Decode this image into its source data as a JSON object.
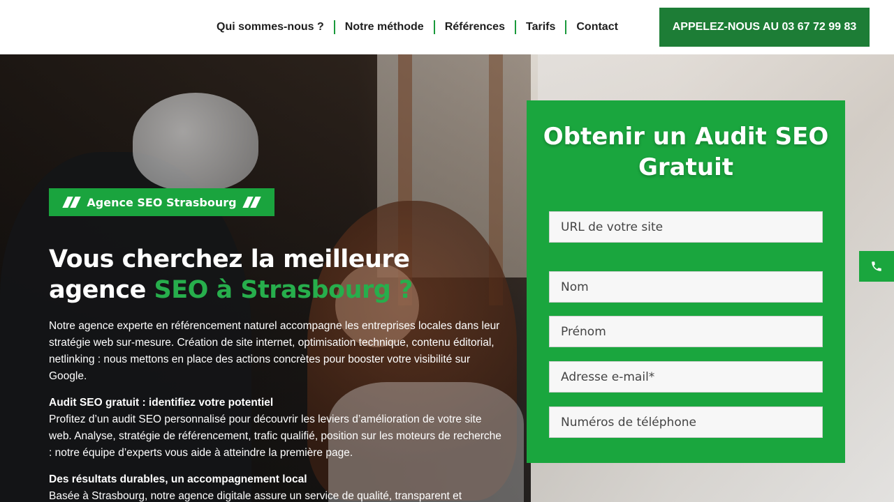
{
  "nav": {
    "items": [
      {
        "label": "Qui sommes-nous ?"
      },
      {
        "label": "Notre méthode"
      },
      {
        "label": "Références"
      },
      {
        "label": "Tarifs"
      },
      {
        "label": "Contact"
      }
    ],
    "cta_label": "APPELEZ-NOUS AU 03 67 72 99 83"
  },
  "hero": {
    "tag": "Agence SEO Strasbourg",
    "title_part1": "Vous cherchez la meilleure",
    "title_part2": "agence",
    "title_accent": "SEO à Strasbourg ?",
    "intro": "Notre agence experte en référencement naturel accompagne les entreprises locales dans leur stratégie web sur-mesure. Création de site internet, optimisation technique, contenu éditorial, netlinking : nous mettons en place des actions concrètes pour booster votre visibilité sur Google.",
    "block1_title": "Audit SEO gratuit : identifiez votre potentiel",
    "block1_text": "Profitez d’un audit SEO personnalisé pour découvrir les leviers d’amélioration de votre site web. Analyse, stratégie de référencement, trafic qualifié, position sur les moteurs de recherche : notre équipe d’experts vous aide à atteindre la première page.",
    "block2_title": "Des résultats durables, un accompagnement local",
    "block2_text": "Basée à Strasbourg, notre agence digitale assure un service de qualité, transparent et"
  },
  "form": {
    "title": "Obtenir un Audit SEO Gratuit",
    "url_placeholder": "URL de votre site",
    "nom_placeholder": "Nom",
    "prenom_placeholder": "Prénom",
    "email_placeholder": "Adresse e-mail*",
    "phone_placeholder": "Numéros de téléphone"
  },
  "colors": {
    "brand_green": "#1aa63e",
    "dark_green": "#1d7d36"
  },
  "icons": {
    "floating": "phone-icon"
  }
}
